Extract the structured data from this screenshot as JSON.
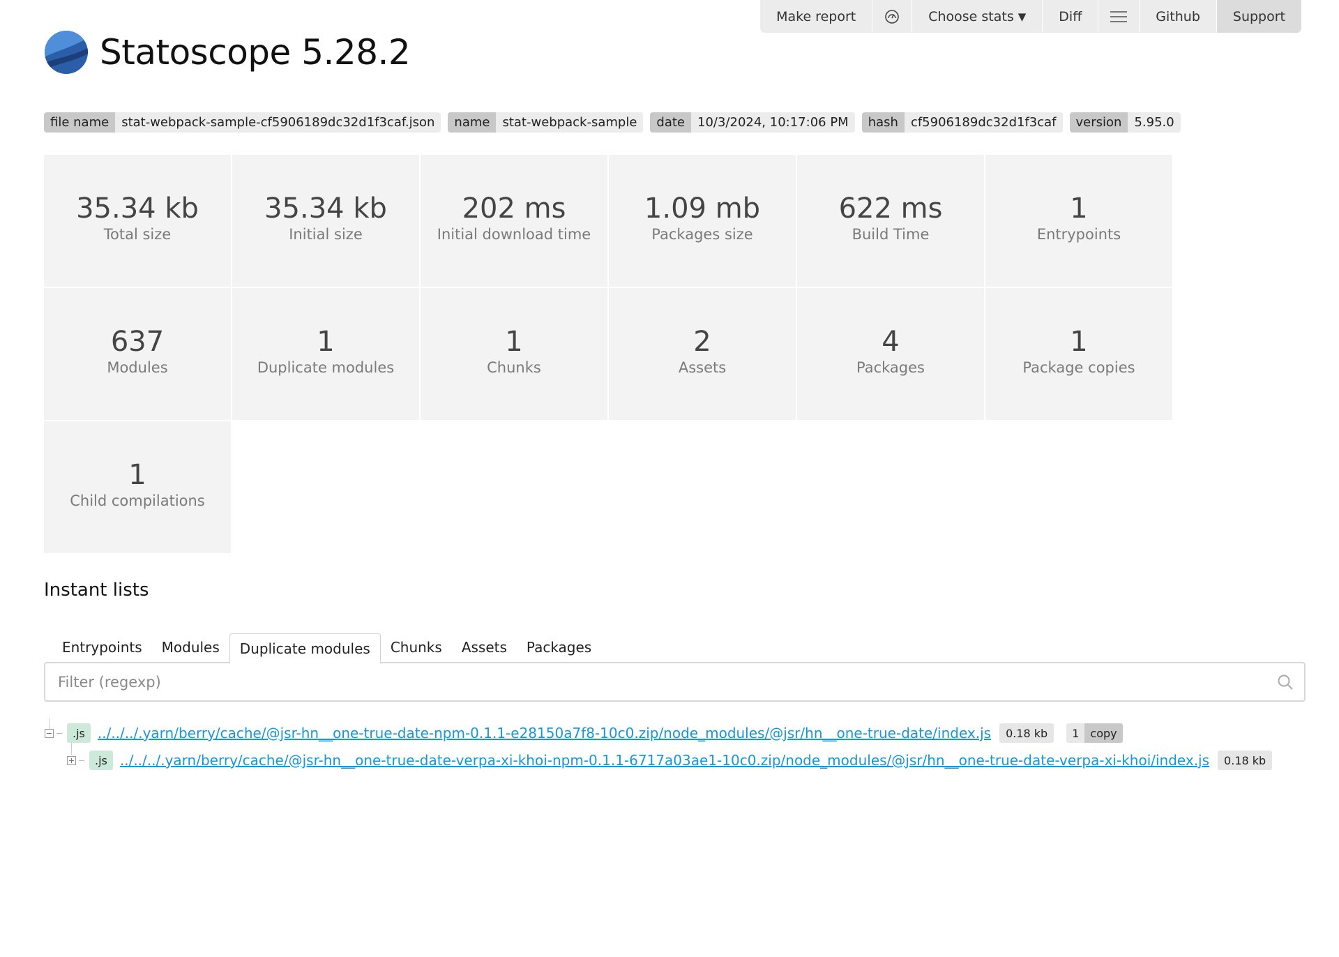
{
  "nav": {
    "make_report": "Make report",
    "choose_stats": "Choose stats",
    "diff": "Diff",
    "github": "Github",
    "support": "Support"
  },
  "header": {
    "title": "Statoscope 5.28.2"
  },
  "meta": [
    {
      "key": "file name",
      "value": "stat-webpack-sample-cf5906189dc32d1f3caf.json"
    },
    {
      "key": "name",
      "value": "stat-webpack-sample"
    },
    {
      "key": "date",
      "value": "10/3/2024, 10:17:06 PM"
    },
    {
      "key": "hash",
      "value": "cf5906189dc32d1f3caf"
    },
    {
      "key": "version",
      "value": "5.95.0"
    }
  ],
  "stats": [
    {
      "value": "35.34 kb",
      "label": "Total size"
    },
    {
      "value": "35.34 kb",
      "label": "Initial size"
    },
    {
      "value": "202 ms",
      "label": "Initial download time"
    },
    {
      "value": "1.09 mb",
      "label": "Packages size"
    },
    {
      "value": "622 ms",
      "label": "Build Time"
    },
    {
      "value": "1",
      "label": "Entrypoints"
    },
    {
      "value": "637",
      "label": "Modules"
    },
    {
      "value": "1",
      "label": "Duplicate modules"
    },
    {
      "value": "1",
      "label": "Chunks"
    },
    {
      "value": "2",
      "label": "Assets"
    },
    {
      "value": "4",
      "label": "Packages"
    },
    {
      "value": "1",
      "label": "Package copies"
    },
    {
      "value": "1",
      "label": "Child compilations"
    }
  ],
  "instant_lists": {
    "title": "Instant lists",
    "tabs": [
      "Entrypoints",
      "Modules",
      "Duplicate modules",
      "Chunks",
      "Assets",
      "Packages"
    ],
    "active_tab": "Duplicate modules",
    "filter_placeholder": "Filter (regexp)"
  },
  "tree": [
    {
      "ext": ".js",
      "path": "../../../.yarn/berry/cache/@jsr-hn__one-true-date-npm-0.1.1-e28150a7f8-10c0.zip/node_modules/@jsr/hn__one-true-date/index.js",
      "size": "0.18 kb",
      "copy_count": "1",
      "copy_label": "copy",
      "expanded": true
    },
    {
      "ext": ".js",
      "path": "../../../.yarn/berry/cache/@jsr-hn__one-true-date-verpa-xi-khoi-npm-0.1.1-6717a03ae1-10c0.zip/node_modules/@jsr/hn__one-true-date-verpa-xi-khoi/index.js",
      "size": "0.18 kb",
      "expanded": false
    }
  ]
}
